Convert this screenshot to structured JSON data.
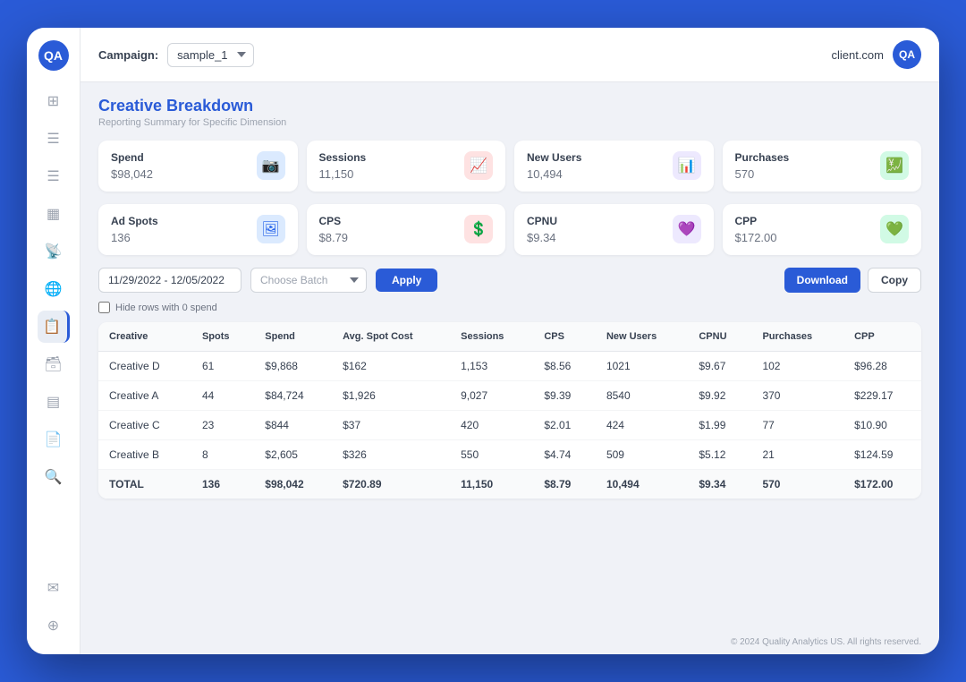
{
  "header": {
    "campaign_label": "Campaign:",
    "campaign_value": "sample_1",
    "client_name": "client.com",
    "logo_text": "QA"
  },
  "page": {
    "title": "Creative Breakdown",
    "subtitle": "Reporting Summary for Specific Dimension"
  },
  "metrics": [
    {
      "id": "spend",
      "title": "Spend",
      "value": "$98,042",
      "icon": "📷",
      "icon_class": "icon-blue"
    },
    {
      "id": "sessions",
      "title": "Sessions",
      "value": "11,150",
      "icon": "📈",
      "icon_class": "icon-red"
    },
    {
      "id": "new_users",
      "title": "New Users",
      "value": "10,494",
      "icon": "📊",
      "icon_class": "icon-purple"
    },
    {
      "id": "purchases",
      "title": "Purchases",
      "value": "570",
      "icon": "💹",
      "icon_class": "icon-green"
    },
    {
      "id": "ad_spots",
      "title": "Ad Spots",
      "value": "136",
      "icon": "🖼",
      "icon_class": "icon-blue"
    },
    {
      "id": "cps",
      "title": "CPS",
      "value": "$8.79",
      "icon": "💲",
      "icon_class": "icon-red"
    },
    {
      "id": "cpnu",
      "title": "CPNU",
      "value": "$9.34",
      "icon": "💜",
      "icon_class": "icon-purple"
    },
    {
      "id": "cpp",
      "title": "CPP",
      "value": "$172.00",
      "icon": "💚",
      "icon_class": "icon-green"
    }
  ],
  "filters": {
    "date_range": "11/29/2022 - 12/05/2022",
    "batch_placeholder": "Choose Batch",
    "apply_label": "Apply",
    "download_label": "Download",
    "copy_label": "Copy",
    "hide_zero_label": "Hide rows with 0 spend"
  },
  "table": {
    "columns": [
      "Creative",
      "Spots",
      "Spend",
      "Avg. Spot Cost",
      "Sessions",
      "CPS",
      "New Users",
      "CPNU",
      "Purchases",
      "CPP"
    ],
    "rows": [
      {
        "creative": "Creative D",
        "spots": "61",
        "spend": "$9,868",
        "avg_spot_cost": "$162",
        "sessions": "1,153",
        "cps": "$8.56",
        "new_users": "1021",
        "cpnu": "$9.67",
        "purchases": "102",
        "cpp": "$96.28"
      },
      {
        "creative": "Creative A",
        "spots": "44",
        "spend": "$84,724",
        "avg_spot_cost": "$1,926",
        "sessions": "9,027",
        "cps": "$9.39",
        "new_users": "8540",
        "cpnu": "$9.92",
        "purchases": "370",
        "cpp": "$229.17"
      },
      {
        "creative": "Creative C",
        "spots": "23",
        "spend": "$844",
        "avg_spot_cost": "$37",
        "sessions": "420",
        "cps": "$2.01",
        "new_users": "424",
        "cpnu": "$1.99",
        "purchases": "77",
        "cpp": "$10.90"
      },
      {
        "creative": "Creative B",
        "spots": "8",
        "spend": "$2,605",
        "avg_spot_cost": "$326",
        "sessions": "550",
        "cps": "$4.74",
        "new_users": "509",
        "cpnu": "$5.12",
        "purchases": "21",
        "cpp": "$124.59"
      }
    ],
    "total": {
      "creative": "TOTAL",
      "spots": "136",
      "spend": "$98,042",
      "avg_spot_cost": "$720.89",
      "sessions": "11,150",
      "cps": "$8.79",
      "new_users": "10,494",
      "cpnu": "$9.34",
      "purchases": "570",
      "cpp": "$172.00"
    }
  },
  "footer": {
    "text": "© 2024 Quality Analytics US. All rights reserved."
  },
  "sidebar": {
    "logo": "QA",
    "icons": [
      "⊞",
      "☰",
      "☰",
      "▦",
      "📡",
      "🌐",
      "📋",
      "🗃",
      "▤",
      "📄",
      "🔍"
    ],
    "bottom_icons": [
      "✉",
      "⊕"
    ]
  }
}
